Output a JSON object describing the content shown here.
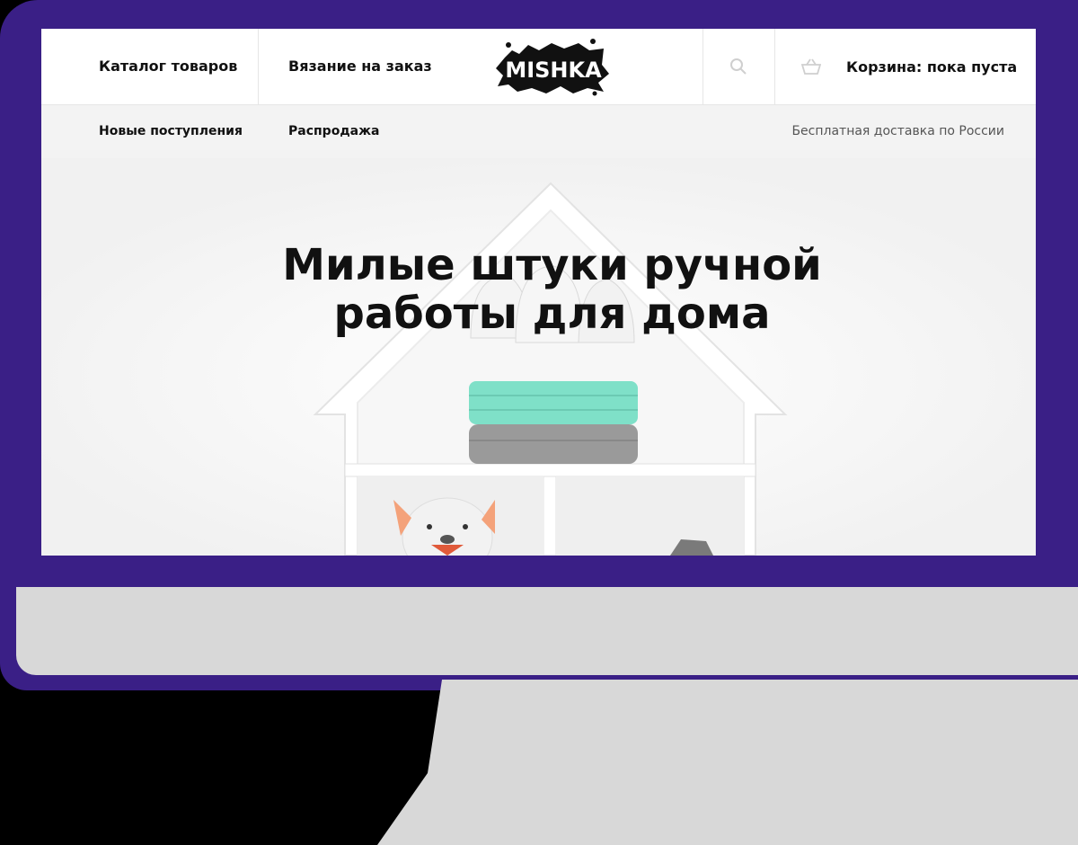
{
  "header": {
    "nav_catalog": "Каталог товаров",
    "nav_knitting": "Вязание на заказ",
    "logo_text": "MISHKA",
    "search_icon": "search-icon",
    "cart_icon": "basket-icon",
    "cart_label": "Корзина: пока пуста"
  },
  "subnav": {
    "new_arrivals": "Новые поступления",
    "sale": "Распродажа",
    "delivery": "Бесплатная доставка по России"
  },
  "hero": {
    "title_line1": "Милые штуки ручной",
    "title_line2": "работы для дома"
  },
  "colors": {
    "frame": "#3a1f86",
    "stand": "#d8d8d8",
    "screen_bg": "#f3f3f3",
    "basket_mint": "#7fe0c8",
    "basket_grey": "#9a9a9a"
  }
}
